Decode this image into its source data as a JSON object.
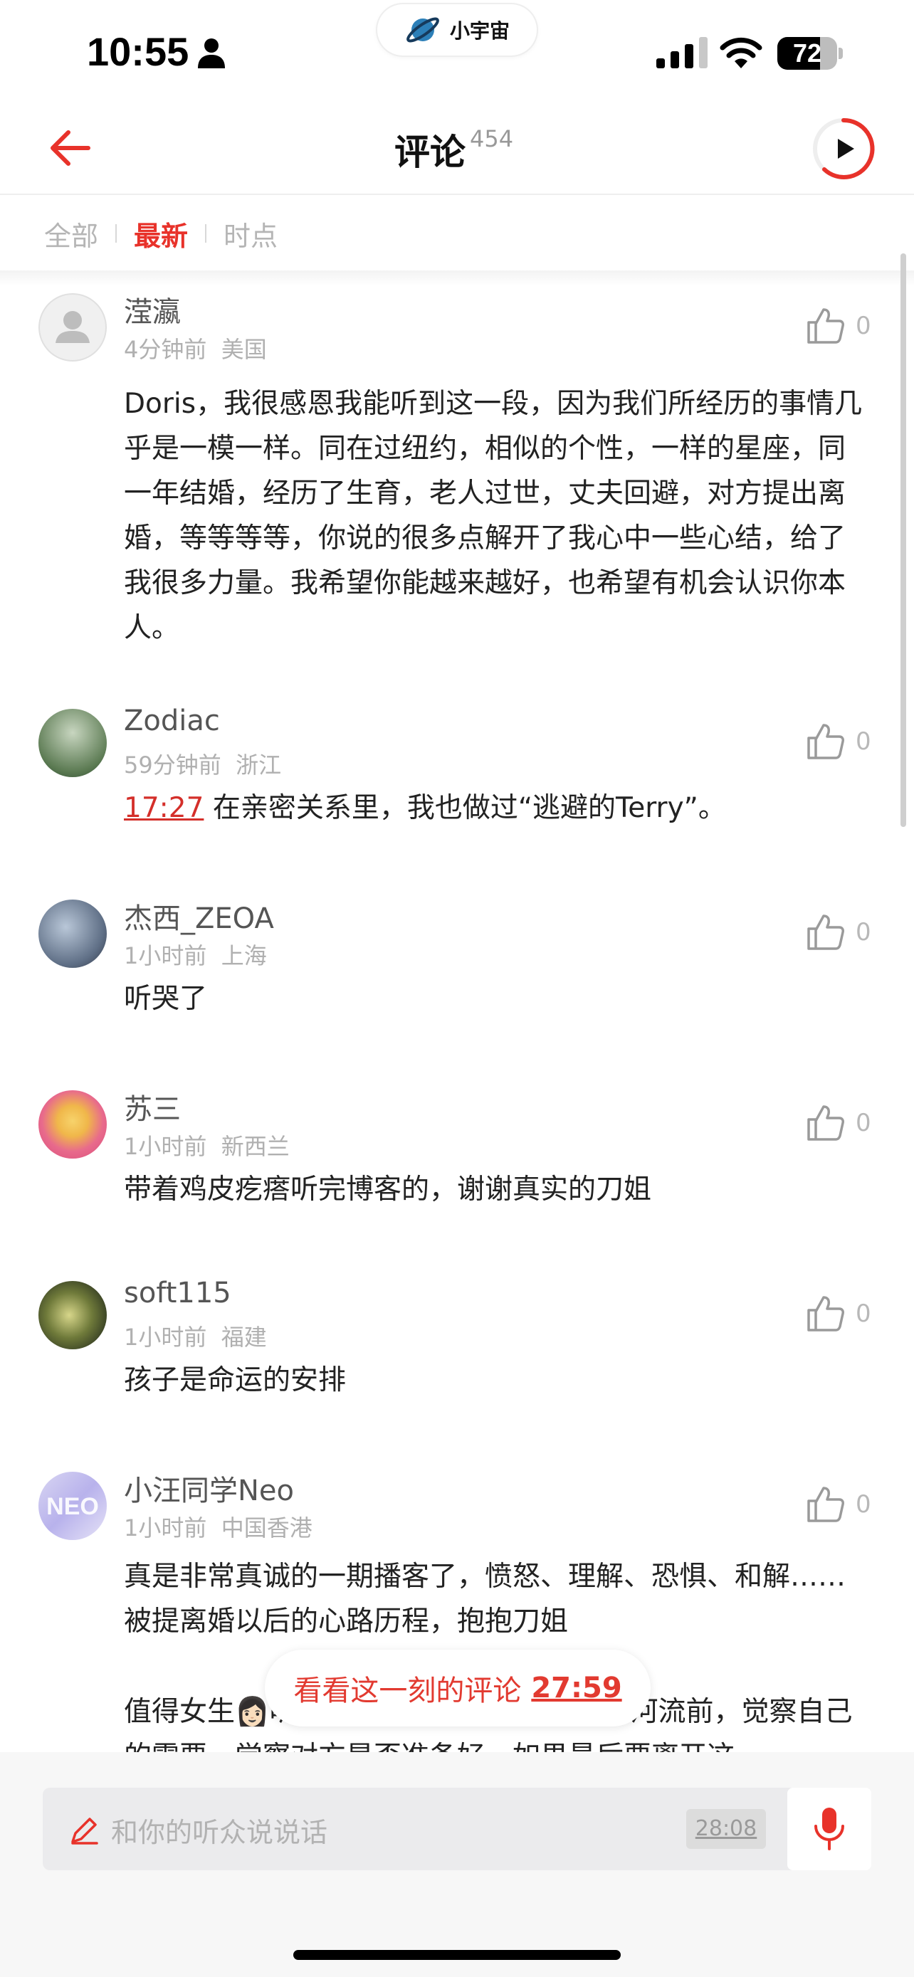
{
  "status_bar": {
    "time": "10:55",
    "island_label": "小宇宙",
    "battery_level": "72"
  },
  "header": {
    "title": "评论",
    "count": "454"
  },
  "tabs": [
    {
      "label": "全部",
      "active": false
    },
    {
      "label": "最新",
      "active": true
    },
    {
      "label": "时点",
      "active": false
    }
  ],
  "comments": [
    {
      "username": "滢瀛",
      "time_ago": "4分钟前",
      "location": "美国",
      "likes": "0",
      "text": "Doris，我很感恩我能听到这一段，因为我们所经历的事情几乎是一模一样。同在过纽约，相似的个性，一样的星座，同一年结婚，经历了生育，老人过世，丈夫回避，对方提出离婚，等等等等，你说的很多点解开了我心中一些心结，给了我很多力量。我希望你能越来越好，也希望有机会认识你本人。"
    },
    {
      "username": "Zodiac",
      "time_ago": "59分钟前",
      "location": "浙江",
      "likes": "0",
      "timestamp": "17:27",
      "text": "在亲密关系里，我也做过“逃避的Terry”。"
    },
    {
      "username": "杰西_ZEOA",
      "time_ago": "1小时前",
      "location": "上海",
      "likes": "0",
      "text": "听哭了"
    },
    {
      "username": "苏三",
      "time_ago": "1小时前",
      "location": "新西兰",
      "likes": "0",
      "text": "带着鸡皮疙瘩听完博客的，谢谢真实的刀姐"
    },
    {
      "username": "soft115",
      "time_ago": "1小时前",
      "location": "福建",
      "likes": "0",
      "text": "孩子是命运的安排"
    },
    {
      "username": "小汪同学Neo",
      "time_ago": "1小时前",
      "location": "中国香港",
      "likes": "0",
      "text": "真是非常真诚的一期播客了，愤怒、理解、恐惧、和解……被提离婚以后的心路历程，抱抱刀姐",
      "text2": "值得女生👩🏻听的一期播客，在踏入婚姻的河流前，觉察自己的需要，觉察对方是否准备好，如果最后要离开这"
    }
  ],
  "jump_pill": {
    "label": "看看这一刻的评论",
    "time": "27:59"
  },
  "input": {
    "placeholder": "和你的听众说说话",
    "time_chip": "28:08"
  },
  "colors": {
    "accent": "#e8322a",
    "muted": "#b0b0b0"
  },
  "icons": [
    "back-arrow-icon",
    "play-icon",
    "thumbs-up-icon",
    "pencil-icon",
    "microphone-icon",
    "wifi-icon",
    "signal-icon",
    "person-icon",
    "planet-icon"
  ]
}
